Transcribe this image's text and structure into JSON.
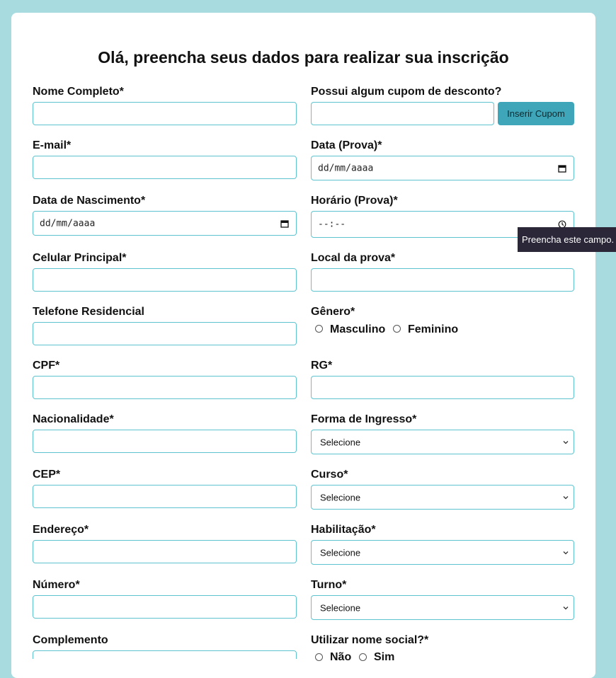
{
  "header": {
    "title": "Olá, preencha seus dados para realizar sua inscrição"
  },
  "fields": {
    "nome": {
      "label": "Nome Completo*"
    },
    "cupom": {
      "label": "Possui algum cupom de desconto?",
      "button": "Inserir Cupom"
    },
    "email": {
      "label": "E-mail*"
    },
    "data_prova": {
      "label": "Data (Prova)*",
      "placeholder": "dd/mm/aaaa"
    },
    "nascimento": {
      "label": "Data de Nascimento*",
      "placeholder": "dd/mm/aaaa"
    },
    "horario": {
      "label": "Horário (Prova)*",
      "placeholder": "--:--"
    },
    "celular": {
      "label": "Celular Principal*"
    },
    "local": {
      "label": "Local da prova*"
    },
    "telefone": {
      "label": "Telefone Residencial"
    },
    "genero": {
      "label": "Gênero*",
      "options": [
        "Masculino",
        "Feminino"
      ]
    },
    "cpf": {
      "label": "CPF*"
    },
    "rg": {
      "label": "RG*"
    },
    "nacionalidade": {
      "label": "Nacionalidade*"
    },
    "ingresso": {
      "label": "Forma de Ingresso*",
      "value": "Selecione"
    },
    "cep": {
      "label": "CEP*"
    },
    "curso": {
      "label": "Curso*",
      "value": "Selecione"
    },
    "endereco": {
      "label": "Endereço*"
    },
    "habilitacao": {
      "label": "Habilitação*",
      "value": "Selecione"
    },
    "numero": {
      "label": "Número*"
    },
    "turno": {
      "label": "Turno*",
      "value": "Selecione"
    },
    "complemento": {
      "label": "Complemento"
    },
    "nome_social": {
      "label": "Utilizar nome social?*",
      "options": [
        "Não",
        "Sim"
      ]
    }
  },
  "tooltip": {
    "text": "Preencha este campo."
  },
  "icons": {
    "calendar": "calendar-icon",
    "clock": "clock-icon",
    "chevron": "chevron-down-icon"
  },
  "colors": {
    "background": "#a8dbe0",
    "border": "#5fc3cf",
    "button": "#3fa6b9",
    "tooltip": "#2b2738"
  }
}
